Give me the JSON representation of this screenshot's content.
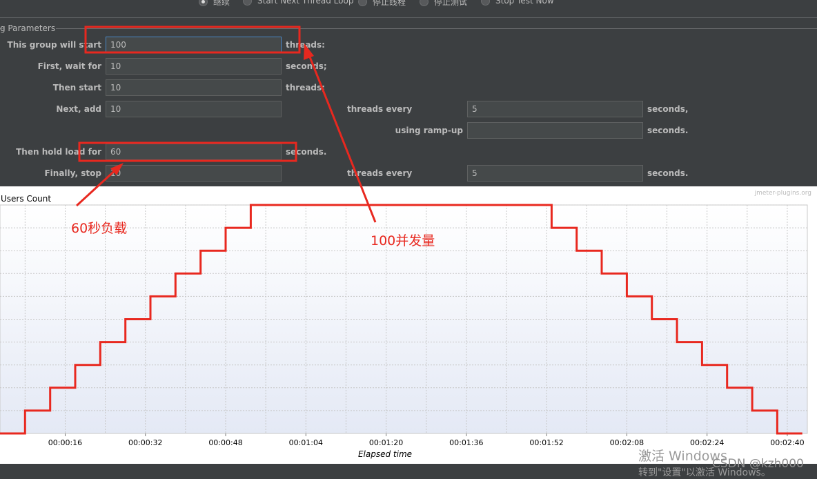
{
  "radios": [
    {
      "label": "继续",
      "selected": true
    },
    {
      "label": "Start Next Thread Loop",
      "selected": false
    },
    {
      "label": "停止线程",
      "selected": false
    },
    {
      "label": "停止测试",
      "selected": false
    },
    {
      "label": "Stop Test Now",
      "selected": false
    }
  ],
  "group_title": "g Parameters",
  "params": {
    "start_label": "This group will start",
    "start_value": "100",
    "start_unit": "threads:",
    "wait_label": "First, wait for",
    "wait_value": "10",
    "wait_unit": "seconds;",
    "then_label": "Then start",
    "then_value": "10",
    "then_unit": "threads;",
    "next_label": "Next, add",
    "next_value": "10",
    "every_label": "threads every",
    "every_value": "5",
    "every_unit": "seconds,",
    "ramp_label": "using ramp-up",
    "ramp_value": "",
    "ramp_unit": "seconds.",
    "hold_label": "Then hold load for",
    "hold_value": "60",
    "hold_unit": "seconds.",
    "stop_label": "Finally, stop",
    "stop_value": "10",
    "stop_every_label": "threads every",
    "stop_every_value": "5",
    "stop_every_unit": "seconds."
  },
  "annotations": {
    "hold": "60秒负载",
    "concurrency": "100并发量"
  },
  "colors": {
    "annotation": "#e8281f",
    "line": "#e8281f",
    "focus": "#4a88c7"
  },
  "watermark": {
    "line1": "激活 Windows",
    "line2": "转到\"设置\"以激活 Windows。",
    "credit": "CSDN @kzh000"
  },
  "chart_data": {
    "type": "line",
    "title": "Users Count",
    "credit": "jmeter-plugins.org",
    "xlabel": "Elapsed time",
    "ylabel": "",
    "x_tick_labels": [
      "00:00:16",
      "00:00:32",
      "00:00:48",
      "00:01:04",
      "00:01:20",
      "00:01:36",
      "00:01:52",
      "00:02:08",
      "00:02:24",
      "00:02:40"
    ],
    "x_tick_seconds": [
      16,
      32,
      48,
      64,
      80,
      96,
      112,
      128,
      144,
      160
    ],
    "xlim": [
      3,
      164
    ],
    "ylim": [
      0,
      100
    ],
    "grid": true,
    "series": [
      {
        "name": "",
        "x": [
          3,
          8,
          8,
          13,
          13,
          18,
          18,
          23,
          23,
          28,
          28,
          33,
          33,
          38,
          38,
          43,
          43,
          48,
          48,
          53,
          53,
          113,
          113,
          118,
          118,
          123,
          123,
          128,
          128,
          133,
          133,
          138,
          138,
          143,
          143,
          148,
          148,
          153,
          153,
          158,
          158,
          163,
          163
        ],
        "y": [
          0,
          0,
          10,
          10,
          20,
          20,
          30,
          30,
          40,
          40,
          50,
          50,
          60,
          60,
          70,
          70,
          80,
          80,
          90,
          90,
          100,
          100,
          90,
          90,
          80,
          80,
          70,
          70,
          60,
          60,
          50,
          50,
          40,
          40,
          30,
          30,
          20,
          20,
          10,
          10,
          0,
          0,
          0
        ]
      }
    ]
  }
}
